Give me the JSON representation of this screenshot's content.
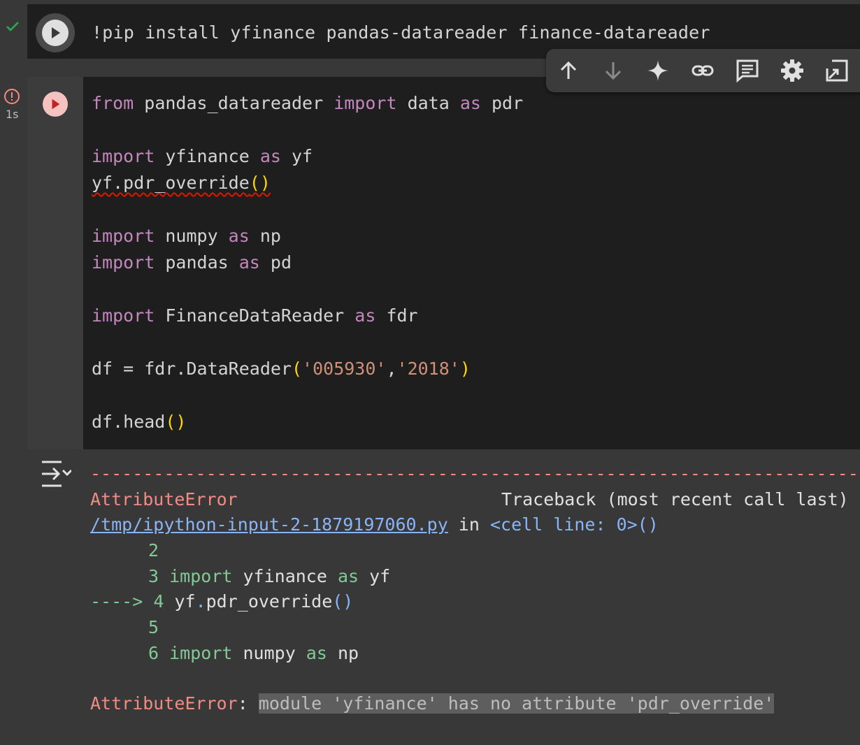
{
  "cell1": {
    "code": "!pip install yfinance pandas-datareader finance-datareader",
    "status": "success"
  },
  "toolbar": {
    "icons": [
      "arrow-up-icon",
      "arrow-down-icon",
      "sparkle-icon",
      "link-icon",
      "comment-icon",
      "gear-icon",
      "mirror-cell-icon"
    ]
  },
  "cell2": {
    "exec_time": "1s",
    "lines": {
      "l1_from": "from",
      "l1_mod": " pandas_datareader ",
      "l1_import": "import",
      "l1_name": " data ",
      "l1_as": "as",
      "l1_alias": " pdr",
      "l2_import": "import",
      "l2_mod": " yfinance ",
      "l2_as": "as",
      "l2_alias": " yf",
      "l3_call": "yf.pdr_override",
      "l4_import": "import",
      "l4_mod": " numpy ",
      "l4_as": "as",
      "l4_alias": " np",
      "l5_import": "import",
      "l5_mod": " pandas ",
      "l5_as": "as",
      "l5_alias": " pd",
      "l6_import": "import",
      "l6_mod": " FinanceDataReader ",
      "l6_as": "as",
      "l6_alias": " fdr",
      "l7_pre": "df = fdr.DataReader",
      "l7_s1": "'005930'",
      "l7_comma": ",",
      "l7_s2": "'2018'",
      "l8_call": "df.head"
    }
  },
  "output": {
    "dashes": "---------------------------------------------------------------------------",
    "error_type": "AttributeError",
    "traceback_label": "Traceback (most recent call last)",
    "file_link": "/tmp/ipython-input-2-1879197060.py",
    "in_text": " in ",
    "cell_line": "<cell line: 0>()",
    "tb2_num": "2",
    "tb3_num": "3",
    "tb3_import": "import",
    "tb3_mod": " yfinance ",
    "tb3_as": "as",
    "tb3_alias": " yf",
    "tb4_arrow": "---->",
    "tb4_num": "4",
    "tb4_obj": "yf",
    "tb4_dot": ".",
    "tb4_attr": "pdr_override",
    "tb4_paren": "()",
    "tb5_num": "5",
    "tb6_num": "6",
    "tb6_import": "import",
    "tb6_mod": " numpy ",
    "tb6_as": "as",
    "tb6_alias": " np",
    "final_type": "AttributeError",
    "final_colon": ": ",
    "final_msg": "module 'yfinance' has no attribute 'pdr_override'"
  }
}
